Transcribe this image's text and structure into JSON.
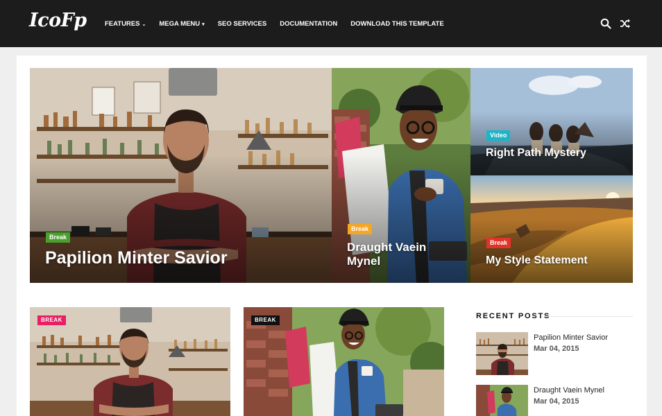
{
  "header": {
    "logo": "IcoFp",
    "nav": [
      {
        "label": "FEATURES",
        "caret": "⌄"
      },
      {
        "label": "MEGA MENU",
        "caret": "▾"
      },
      {
        "label": "SEO SERVICES",
        "caret": ""
      },
      {
        "label": "DOCUMENTATION",
        "caret": ""
      },
      {
        "label": "DOWNLOAD THIS TEMPLATE",
        "caret": ""
      }
    ],
    "icons": [
      "search-icon",
      "shuffle-icon"
    ]
  },
  "featured": [
    {
      "badge": "Break",
      "badge_color": "#4aa02c",
      "title": "Papilion Minter Savior"
    },
    {
      "badge": "Break",
      "badge_color": "#f5a623",
      "title": "Draught Vaein Mynel"
    },
    {
      "badge": "Video",
      "badge_color": "#1ab5c9",
      "title": "Right Path Mystery"
    },
    {
      "badge": "Break",
      "badge_color": "#e0342b",
      "title": "My Style Statement"
    }
  ],
  "posts": [
    {
      "badge": "BREAK",
      "badge_color": "#e91e63"
    },
    {
      "badge": "BREAK",
      "badge_color": "#111111"
    }
  ],
  "sidebar": {
    "heading": "RECENT POSTS",
    "items": [
      {
        "title": "Papilion Minter Savior",
        "date": "Mar 04, 2015"
      },
      {
        "title": "Draught Vaein Mynel",
        "date": "Mar 04, 2015"
      }
    ]
  }
}
